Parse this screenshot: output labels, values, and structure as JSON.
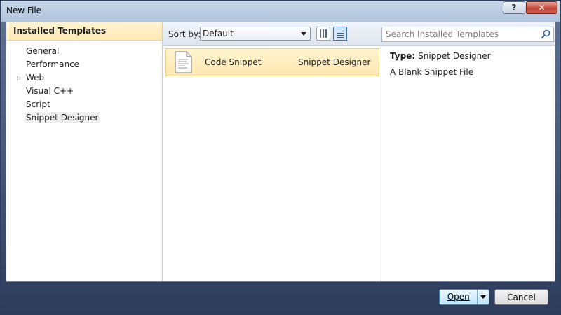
{
  "window": {
    "title": "New File",
    "help_label": "?",
    "close_label": "✕"
  },
  "left_panel": {
    "header": "Installed Templates",
    "items": [
      {
        "label": "General",
        "expandable": false,
        "selected": false
      },
      {
        "label": "Performance",
        "expandable": false,
        "selected": false
      },
      {
        "label": "Web",
        "expandable": true,
        "selected": false
      },
      {
        "label": "Visual C++",
        "expandable": false,
        "selected": false
      },
      {
        "label": "Script",
        "expandable": false,
        "selected": false
      },
      {
        "label": "Snippet Designer",
        "expandable": false,
        "selected": true
      }
    ]
  },
  "toolbar": {
    "sort_label": "Sort by:",
    "sort_value": "Default",
    "search_placeholder": "Search Installed Templates"
  },
  "templates": [
    {
      "name": "Code Snippet",
      "type": "Snippet Designer",
      "icon": "file-icon"
    }
  ],
  "details": {
    "type_label": "Type:",
    "type_value": "Snippet Designer",
    "description": "A Blank Snippet File"
  },
  "buttons": {
    "open_label": "Open",
    "cancel_label": "Cancel"
  },
  "colors": {
    "selection_bg": "#fde9b5",
    "frame": "#2c3c5a"
  }
}
